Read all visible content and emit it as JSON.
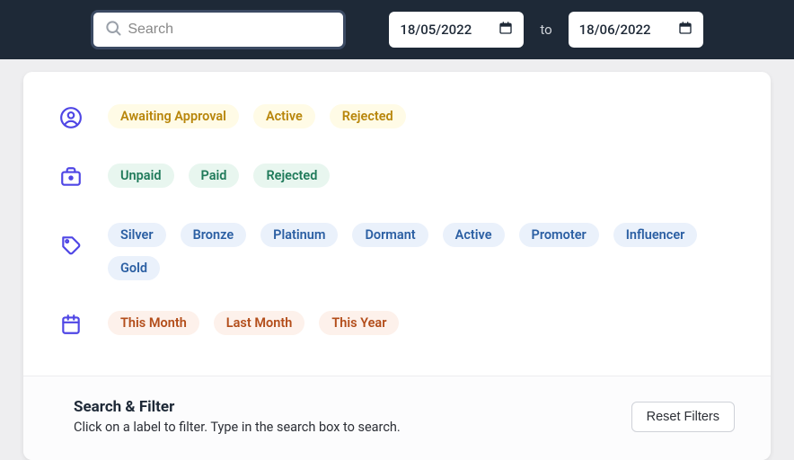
{
  "topbar": {
    "search_placeholder": "Search",
    "date_from": "18/05/2022",
    "date_to": "18/06/2022",
    "to_label": "to"
  },
  "filter_rows": {
    "status": [
      "Awaiting Approval",
      "Active",
      "Rejected"
    ],
    "payment": [
      "Unpaid",
      "Paid",
      "Rejected"
    ],
    "tags": [
      "Silver",
      "Bronze",
      "Platinum",
      "Dormant",
      "Active",
      "Promoter",
      "Influencer",
      "Gold"
    ],
    "date_range": [
      "This Month",
      "Last Month",
      "This Year"
    ]
  },
  "footer": {
    "title": "Search & Filter",
    "subtitle": "Click on a label to filter. Type in the search box to search.",
    "reset_label": "Reset Filters"
  },
  "colors": {
    "indigo": "#4f46e5",
    "topbar": "#1e2937"
  }
}
